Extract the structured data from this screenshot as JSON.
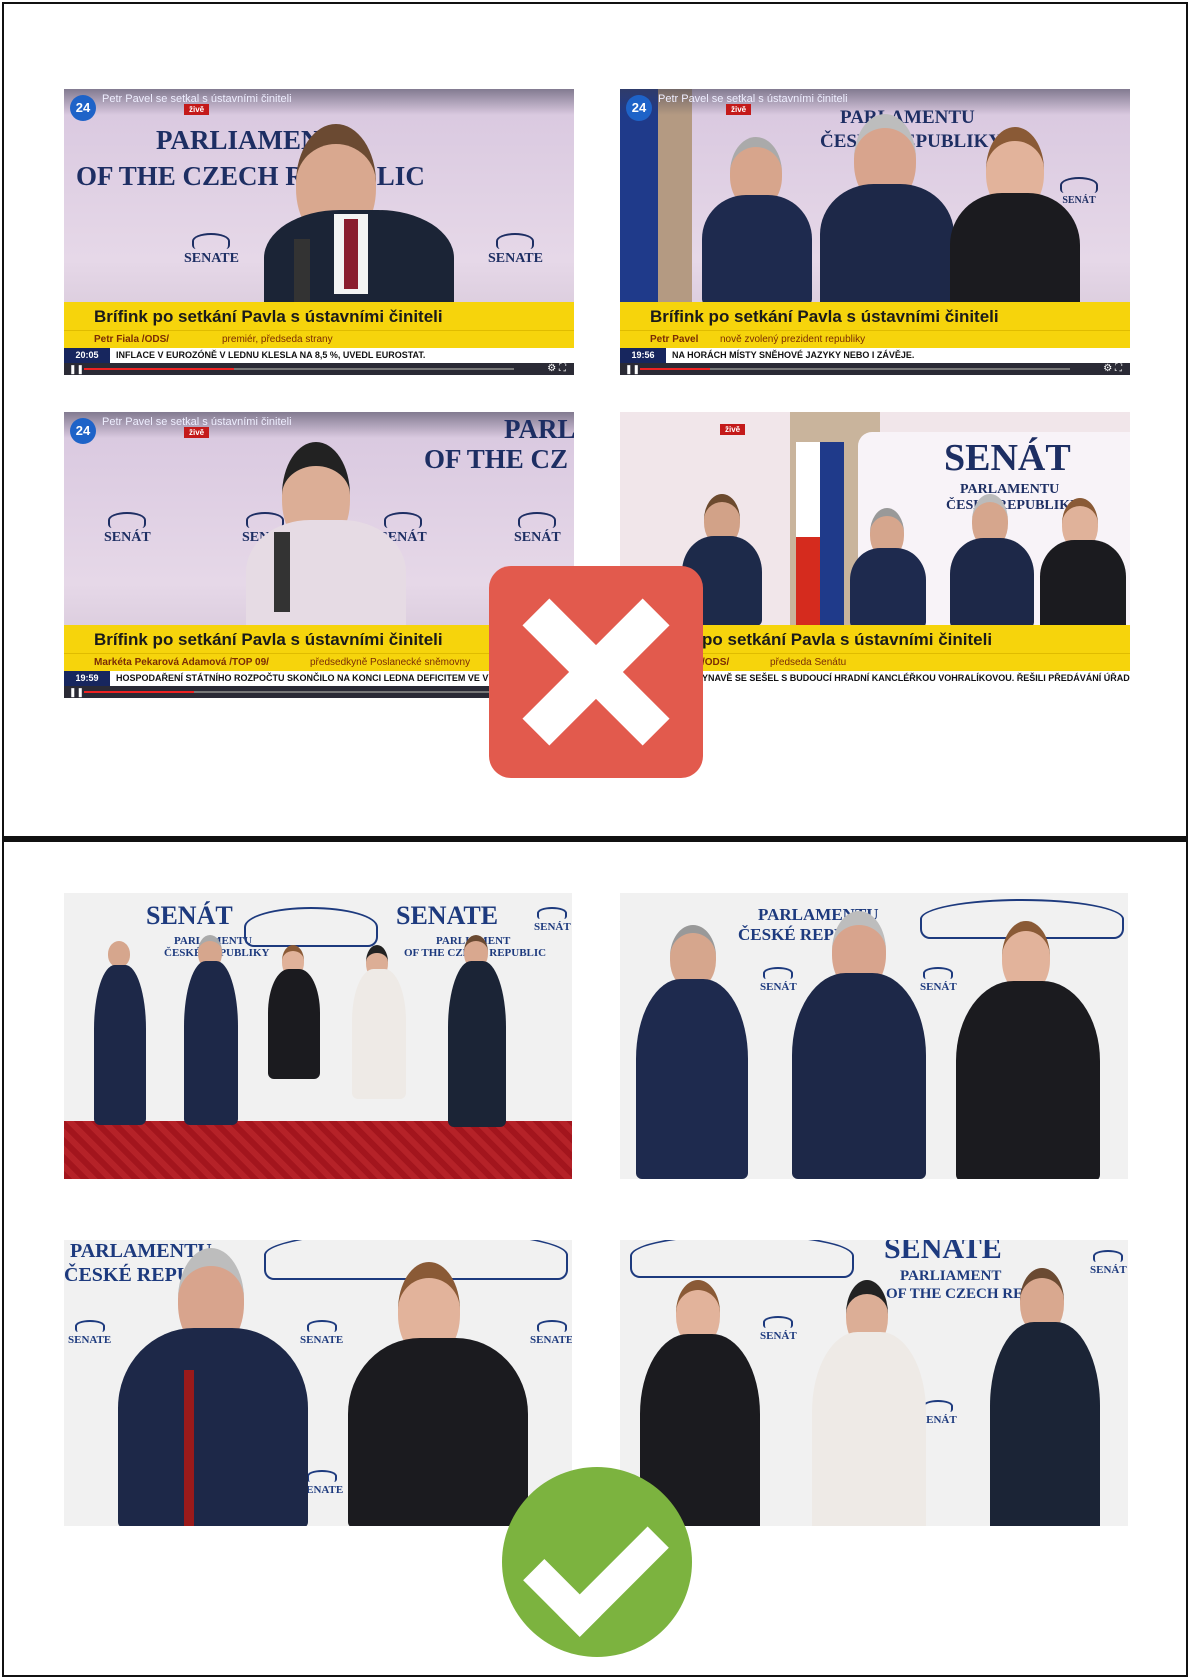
{
  "top": {
    "tl": {
      "channel": "24",
      "headline": "Petr Pavel se setkal s ústavními činiteli",
      "live": "živě",
      "wall_line1": "PARLIAMENT",
      "wall_line2": "OF THE CZECH REPUBLIC",
      "logo": "SENATE",
      "bar_title": "Brífink po setkání Pavla s ústavními činiteli",
      "name": "Petr Fiala /ODS/",
      "role": "premiér, předseda strany",
      "time": "20:05",
      "ticker": "INFLACE V EUROZÓNĚ V LEDNU KLESLA NA 8,5 %, UVEDL EUROSTAT."
    },
    "tr": {
      "channel": "24",
      "headline": "Petr Pavel se setkal s ústavními činiteli",
      "live": "živě",
      "wall_line1": "PARLAMENTU",
      "wall_line2": "ČESKÉ REPUBLIKY",
      "logo": "SENÁT",
      "bar_title": "Brífink po setkání Pavla s ústavními činiteli",
      "name": "Petr Pavel",
      "role": "nově zvolený prezident republiky",
      "time": "19:56",
      "ticker": "NA HORÁCH MÍSTY SNĚHOVÉ JAZYKY NEBO I ZÁVĚJE."
    },
    "bl": {
      "channel": "24",
      "headline": "Petr Pavel se setkal s ústavními činiteli",
      "live": "živě",
      "wall_line1": "PARL",
      "wall_line2": "OF THE CZ",
      "logo": "SENÁT",
      "bar_title": "Brífink po setkání Pavla s ústavními činiteli",
      "name": "Markéta Pekarová Adamová /TOP 09/",
      "role": "předsedkyně Poslanecké sněmovny",
      "time": "19:59",
      "ticker": "HOSPODAŘENÍ STÁTNÍHO ROZPOČTU SKONČILO NA KONCI LEDNA DEFICITEM VE VÝŠI"
    },
    "br": {
      "live": "živě",
      "wall_line1": "SENÁT",
      "wall_line2": "PARLAMENTU",
      "wall_line3": "ČESKÉ REPUBLIKY",
      "bar_title": "po setkání Pavla s ústavními činiteli",
      "name": "/ODS/",
      "role": "předseda Senátu",
      "ticker": "YNAVĚ SE SEŠEL S BUDOUCÍ HRADNÍ KANCLÉŘKOU VOHRALÍKOVOU. ŘEŠILI PŘEDÁVÁNÍ ÚŘADU."
    }
  },
  "bottom": {
    "p1": {
      "wall_a": "SENÁT",
      "wall_b": "SENATE",
      "sub_a": "PARLAMENTU",
      "sub_b": "ČESKÉ REPUBLIKY",
      "sub_c": "PARLIAMENT",
      "sub_d": "OF THE CZECH REPUBLIC",
      "logo": "SENÁT"
    },
    "p2": {
      "wall_a": "PARLAMENTU",
      "wall_b": "ČESKÉ REPU",
      "logo": "SENÁT"
    },
    "p3": {
      "wall_a": "PARLAMENTU",
      "wall_b": "ČESKÉ REPU",
      "logo": "SENATE"
    },
    "p4": {
      "wall_a": "SENATE",
      "wall_b": "PARLIAMENT",
      "wall_c": "OF THE CZECH REPUBL",
      "logo": "SENÁT"
    }
  },
  "colors": {
    "news_bar": "#f6d40c",
    "wrong": "#e25a4d",
    "right": "#7cb33f",
    "navy": "#1d2e63"
  },
  "icons": {
    "wrong": "close-icon",
    "right": "check-icon"
  }
}
